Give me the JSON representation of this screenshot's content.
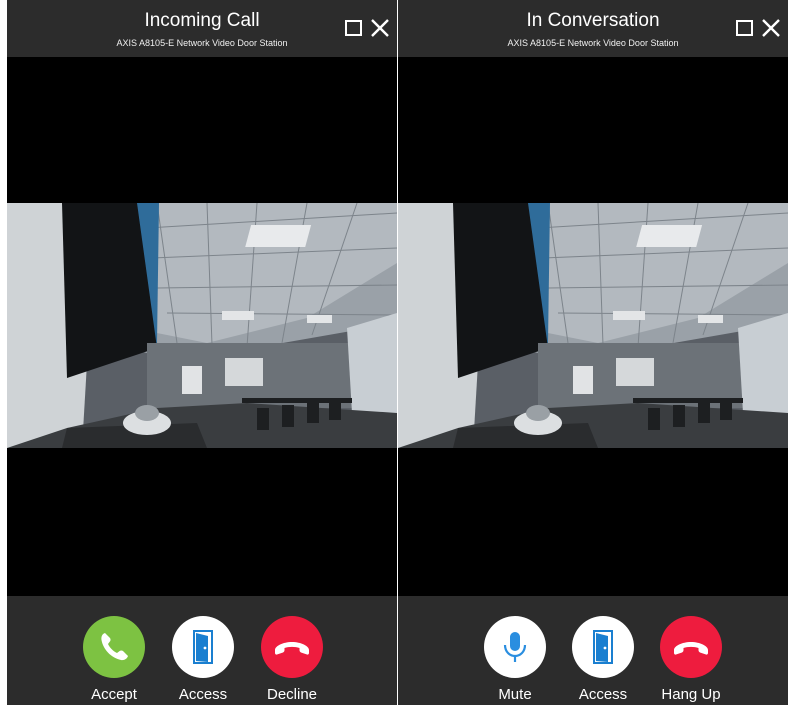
{
  "incoming": {
    "title": "Incoming Call",
    "subtitle": "AXIS A8105-E Network Video Door Station",
    "actions": {
      "accept": "Accept",
      "access": "Access",
      "decline": "Decline"
    }
  },
  "conversation": {
    "title": "In Conversation",
    "subtitle": "AXIS A8105-E Network Video Door Station",
    "actions": {
      "mute": "Mute",
      "access": "Access",
      "hangup": "Hang Up"
    }
  },
  "colors": {
    "accept": "#7dc242",
    "decline": "#ee1c3e",
    "access_blue": "#1a7fd0",
    "mute_blue": "#2a8ee0",
    "bar": "#2c2c2c"
  },
  "icons": {
    "accept": "phone-icon",
    "access": "door-icon",
    "decline": "hang-up-icon",
    "mute": "microphone-icon"
  }
}
